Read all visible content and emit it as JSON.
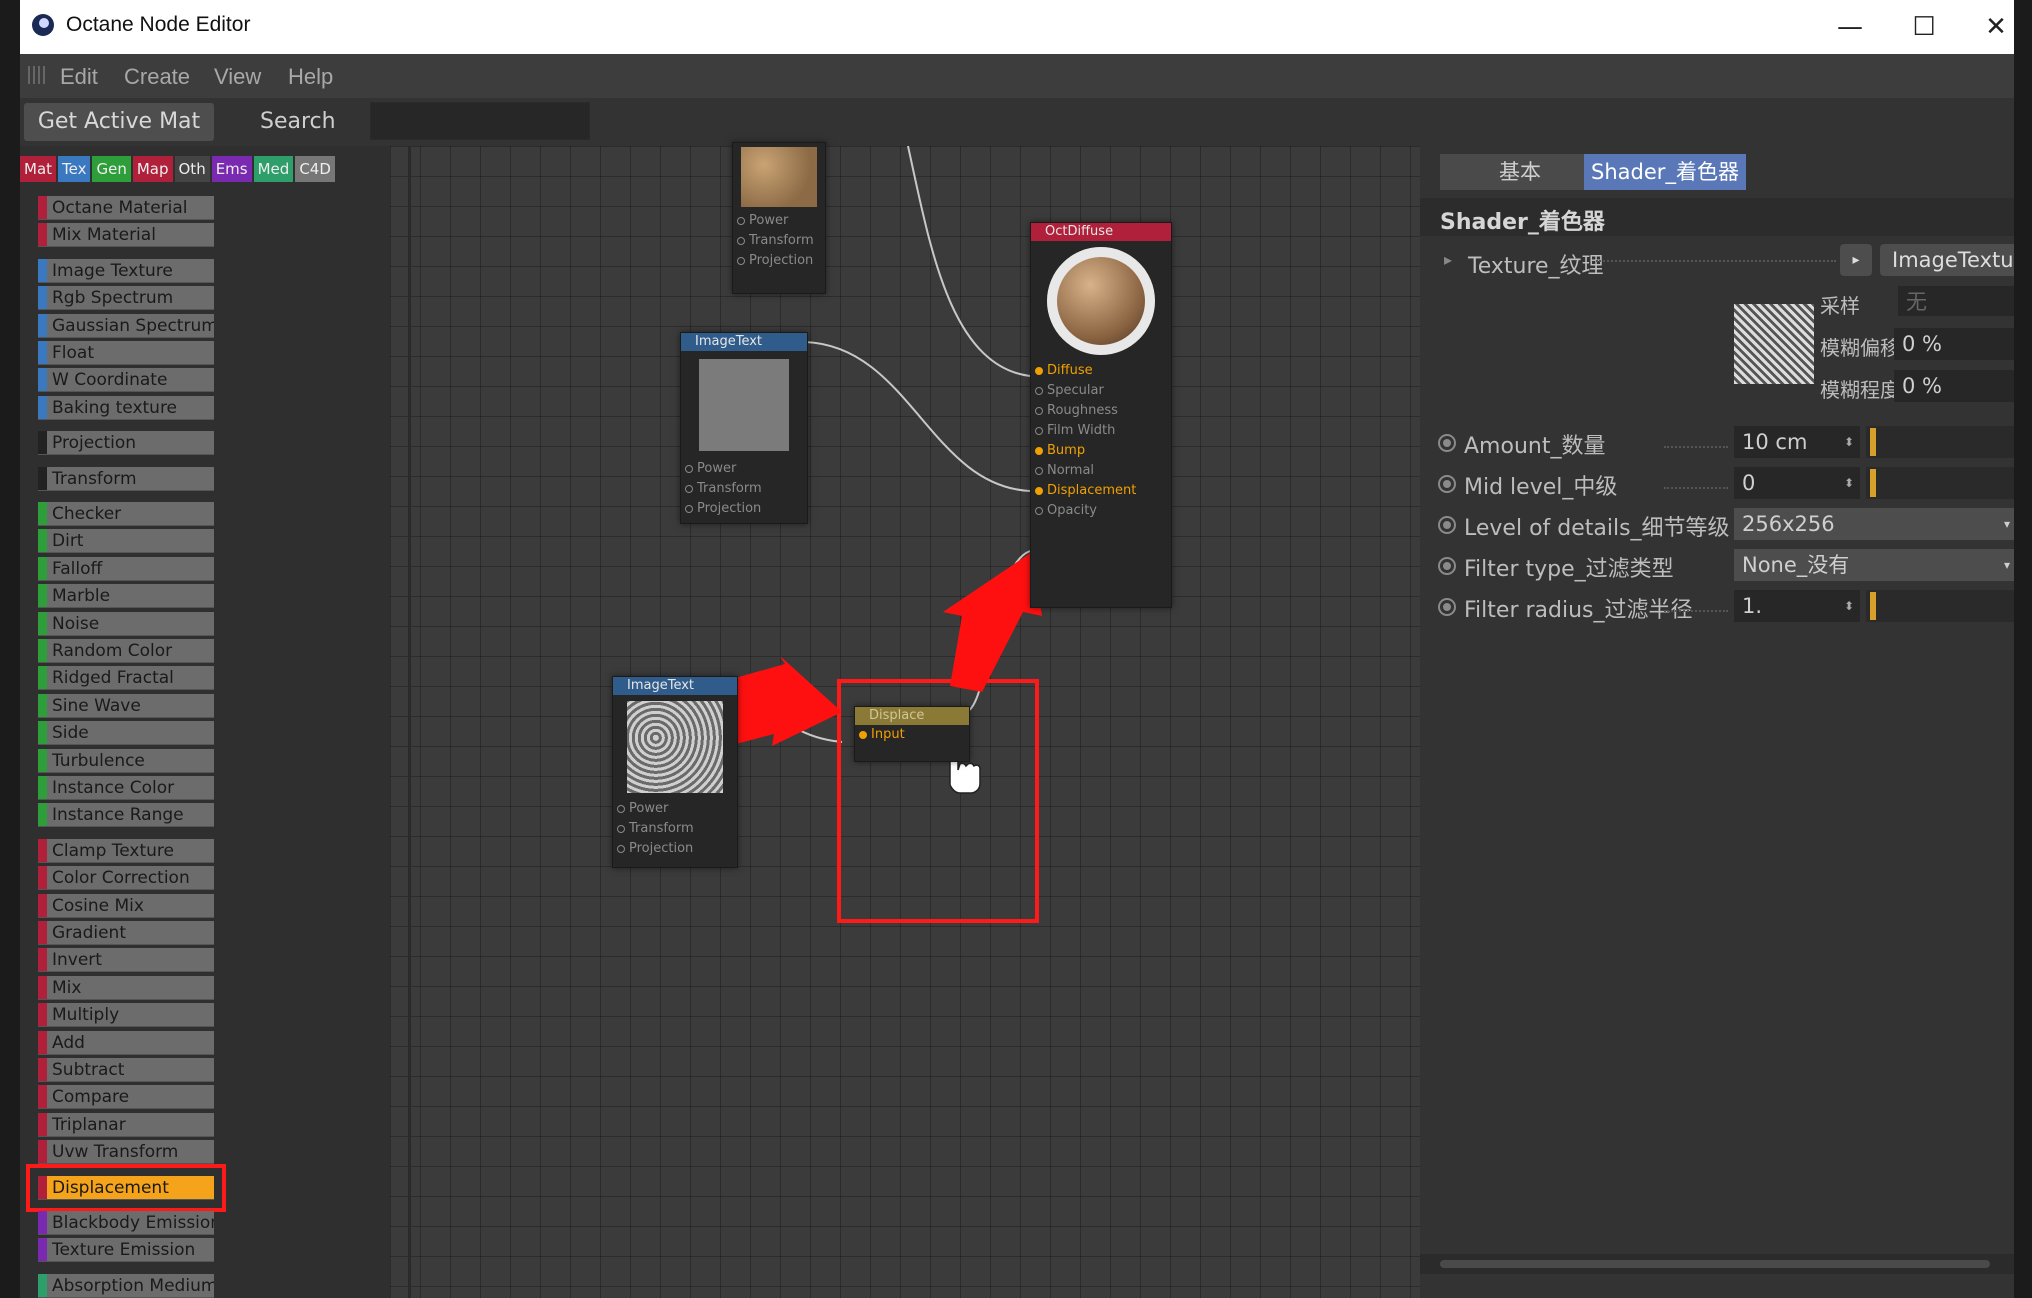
{
  "window": {
    "title": "Octane Node Editor",
    "minimize": "—",
    "maximize": "☐",
    "close": "✕"
  },
  "menu": [
    "Edit",
    "Create",
    "View",
    "Help"
  ],
  "toolbar": {
    "get_active_mat": "Get Active Mat",
    "search_label": "Search",
    "search_value": ""
  },
  "categories": [
    {
      "label": "Mat",
      "color": "#b0203a"
    },
    {
      "label": "Tex",
      "color": "#3a78c0"
    },
    {
      "label": "Gen",
      "color": "#2e9e3a"
    },
    {
      "label": "Map",
      "color": "#b0203a"
    },
    {
      "label": "Oth",
      "color": "#444444"
    },
    {
      "label": "Ems",
      "color": "#7a2ab0"
    },
    {
      "label": "Med",
      "color": "#2e9e6a"
    },
    {
      "label": "C4D",
      "color": "#777777"
    }
  ],
  "node_list": [
    {
      "label": "Octane Material",
      "color": "#b0203a",
      "gap": false
    },
    {
      "label": "Mix Material",
      "color": "#b0203a",
      "gap": false
    },
    {
      "label": "Image Texture",
      "color": "#3a78c0",
      "gap": true
    },
    {
      "label": "Rgb Spectrum",
      "color": "#3a78c0",
      "gap": false
    },
    {
      "label": "Gaussian Spectrum",
      "color": "#3a78c0",
      "gap": false
    },
    {
      "label": "Float",
      "color": "#3a78c0",
      "gap": false
    },
    {
      "label": "W Coordinate",
      "color": "#3a78c0",
      "gap": false
    },
    {
      "label": "Baking texture",
      "color": "#3a78c0",
      "gap": false
    },
    {
      "label": "Projection",
      "color": "#222222",
      "gap": true
    },
    {
      "label": "Transform",
      "color": "#222222",
      "gap": true
    },
    {
      "label": "Checker",
      "color": "#2e9e3a",
      "gap": true
    },
    {
      "label": "Dirt",
      "color": "#2e9e3a",
      "gap": false
    },
    {
      "label": "Falloff",
      "color": "#2e9e3a",
      "gap": false
    },
    {
      "label": "Marble",
      "color": "#2e9e3a",
      "gap": false
    },
    {
      "label": "Noise",
      "color": "#2e9e3a",
      "gap": false
    },
    {
      "label": "Random Color",
      "color": "#2e9e3a",
      "gap": false
    },
    {
      "label": "Ridged Fractal",
      "color": "#2e9e3a",
      "gap": false
    },
    {
      "label": "Sine Wave",
      "color": "#2e9e3a",
      "gap": false
    },
    {
      "label": "Side",
      "color": "#2e9e3a",
      "gap": false
    },
    {
      "label": "Turbulence",
      "color": "#2e9e3a",
      "gap": false
    },
    {
      "label": "Instance Color",
      "color": "#2e9e3a",
      "gap": false
    },
    {
      "label": "Instance Range",
      "color": "#2e9e3a",
      "gap": false
    },
    {
      "label": "Clamp Texture",
      "color": "#b0203a",
      "gap": true
    },
    {
      "label": "Color Correction",
      "color": "#b0203a",
      "gap": false
    },
    {
      "label": "Cosine Mix",
      "color": "#b0203a",
      "gap": false
    },
    {
      "label": "Gradient",
      "color": "#b0203a",
      "gap": false
    },
    {
      "label": "Invert",
      "color": "#b0203a",
      "gap": false
    },
    {
      "label": "Mix",
      "color": "#b0203a",
      "gap": false
    },
    {
      "label": "Multiply",
      "color": "#b0203a",
      "gap": false
    },
    {
      "label": "Add",
      "color": "#b0203a",
      "gap": false
    },
    {
      "label": "Subtract",
      "color": "#b0203a",
      "gap": false
    },
    {
      "label": "Compare",
      "color": "#b0203a",
      "gap": false
    },
    {
      "label": "Triplanar",
      "color": "#b0203a",
      "gap": false
    },
    {
      "label": "Uvw Transform",
      "color": "#b0203a",
      "gap": false
    },
    {
      "label": "Displacement",
      "color": "#b0203a",
      "gap": true,
      "highlight": true
    },
    {
      "label": "Blackbody Emission",
      "color": "#7a2ab0",
      "gap": true
    },
    {
      "label": "Texture Emission",
      "color": "#7a2ab0",
      "gap": false
    },
    {
      "label": "Absorption Medium",
      "color": "#2e9e6a",
      "gap": true
    }
  ],
  "nodes": {
    "top_texture": {
      "pins": [
        "Power",
        "Transform",
        "Projection"
      ]
    },
    "image_text_1": {
      "title": "ImageText",
      "pins": [
        "Power",
        "Transform",
        "Projection"
      ]
    },
    "image_text_2": {
      "title": "ImageText",
      "pins": [
        "Power",
        "Transform",
        "Projection"
      ]
    },
    "oct_diffuse": {
      "title": "OctDiffuse",
      "pins": [
        {
          "label": "Diffuse",
          "active": true
        },
        {
          "label": "Specular",
          "active": false
        },
        {
          "label": "Roughness",
          "active": false
        },
        {
          "label": "Film Width",
          "active": false
        },
        {
          "label": "Bump",
          "active": true
        },
        {
          "label": "Normal",
          "active": false
        },
        {
          "label": "Displacement",
          "active": true
        },
        {
          "label": "Opacity",
          "active": false
        }
      ]
    },
    "displace": {
      "title": "Displace",
      "pins": [
        "Input"
      ]
    }
  },
  "right_panel": {
    "tab_basic": "基本",
    "tab_shader": "Shader_着色器",
    "section_title": "Shader_着色器",
    "texture_label": "Texture_纹理",
    "texture_value": "ImageTexture_图",
    "texture_more": "...",
    "sample_label": "采样",
    "sample_value": "无",
    "blur_offset_label": "模糊偏移",
    "blur_offset_value": "0 %",
    "blur_amount_label": "模糊程度",
    "blur_amount_value": "0 %",
    "props": [
      {
        "label": "Amount_数量",
        "value": "10 cm",
        "stepper": true,
        "slider": true
      },
      {
        "label": "Mid level_中级",
        "value": "0",
        "stepper": true,
        "slider": true
      },
      {
        "label": "Level of details_细节等级",
        "value": "256x256",
        "dropdown": true
      },
      {
        "label": "Filter type_过滤类型",
        "value": "None_没有",
        "dropdown": true
      },
      {
        "label": "Filter radius_过滤半径",
        "value": "1.",
        "stepper": true,
        "slider": true
      }
    ]
  }
}
